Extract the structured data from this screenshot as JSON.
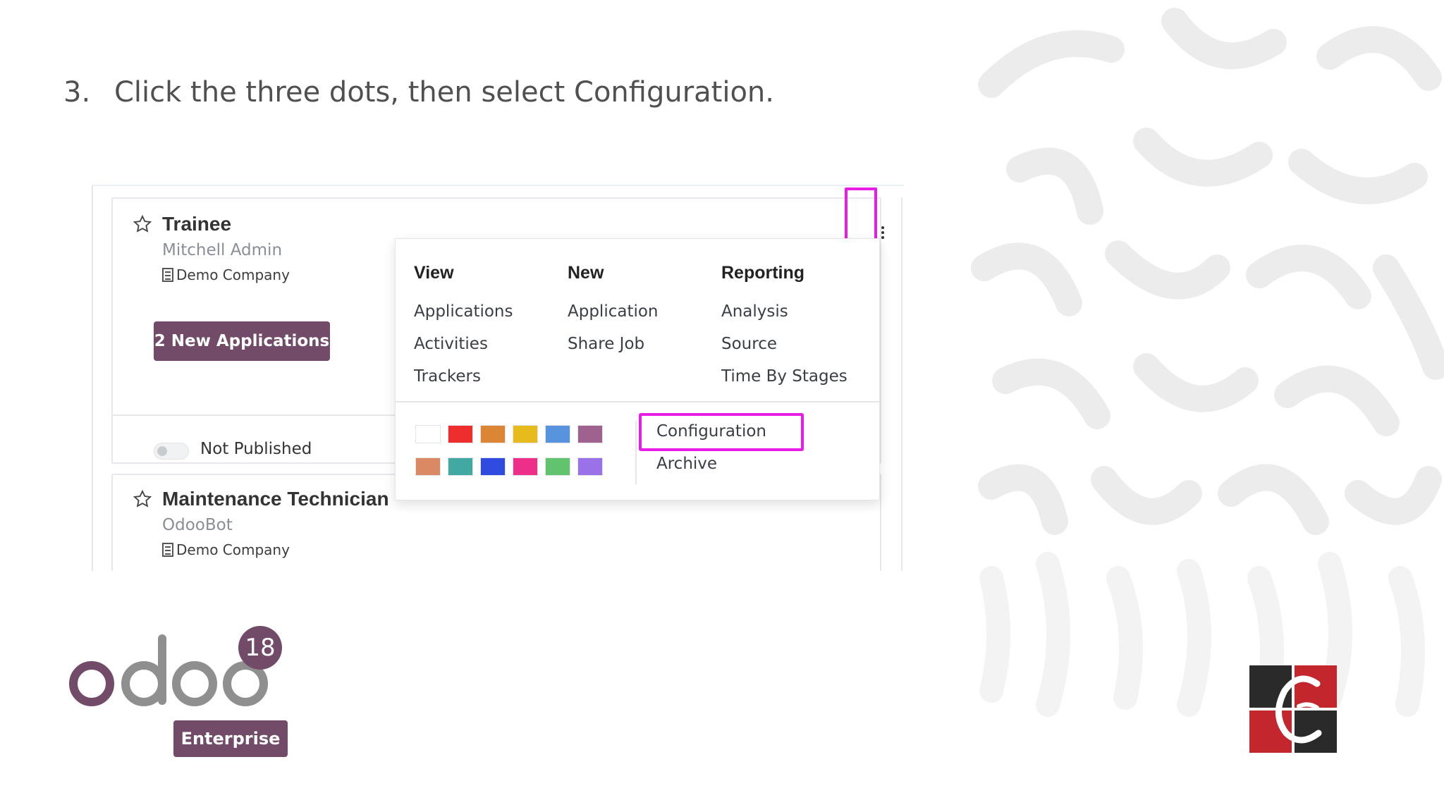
{
  "instruction": {
    "number": "3.",
    "text": "Click the three dots, then select Configuration."
  },
  "jobs": [
    {
      "title": "Trainee",
      "owner": "Mitchell Admin",
      "company": "Demo Company",
      "applications_button": "2 New Applications",
      "publish_status": "Not Published"
    },
    {
      "title": "Maintenance Technician",
      "owner": "OdooBot",
      "company": "Demo Company"
    }
  ],
  "dropdown": {
    "columns": [
      {
        "heading": "View",
        "items": [
          "Applications",
          "Activities",
          "Trackers"
        ]
      },
      {
        "heading": "New",
        "items": [
          "Application",
          "Share Job"
        ]
      },
      {
        "heading": "Reporting",
        "items": [
          "Analysis",
          "Source",
          "Time By Stages"
        ]
      }
    ],
    "actions": [
      "Configuration",
      "Archive"
    ],
    "colors": [
      "#ffffff",
      "#ee2d2d",
      "#dc8534",
      "#e8bb1d",
      "#5794dd",
      "#9f628f",
      "#db8865",
      "#41a9a2",
      "#304be0",
      "#ee2f8a",
      "#61c36e",
      "#9872e6"
    ]
  },
  "highlight_color": "#e91ce6",
  "brand": {
    "product": "odoo",
    "version": "18",
    "edition": "Enterprise",
    "accent": "#714b67"
  }
}
